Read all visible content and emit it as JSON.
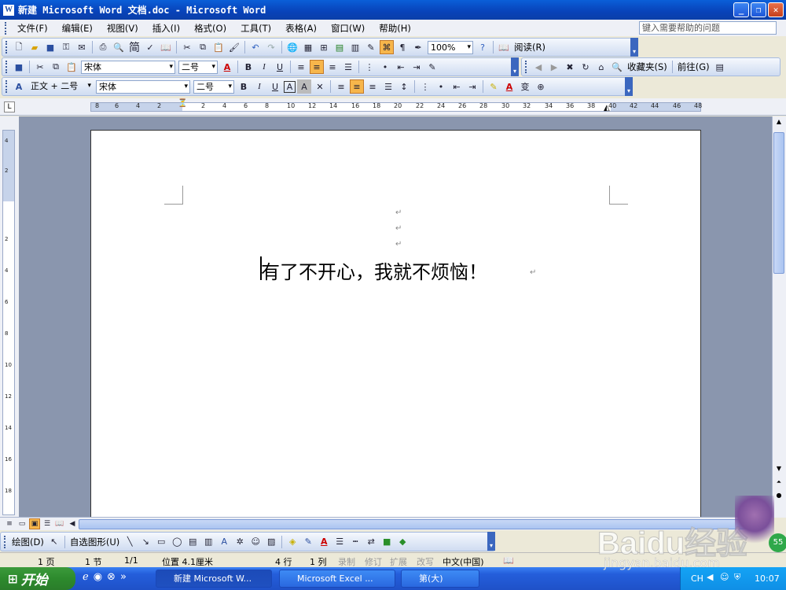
{
  "window": {
    "title": "新建 Microsoft Word 文档.doc - Microsoft Word",
    "app_icon": "W"
  },
  "menu": {
    "items": [
      "文件(F)",
      "编辑(E)",
      "视图(V)",
      "插入(I)",
      "格式(O)",
      "工具(T)",
      "表格(A)",
      "窗口(W)",
      "帮助(H)"
    ],
    "help_placeholder": "键入需要帮助的问题"
  },
  "toolbar_standard": {
    "zoom": "100%",
    "read_label": "阅读(R)",
    "simp_label": "简"
  },
  "toolbar_format": {
    "font": "宋体",
    "size": "二号",
    "favorites": "收藏夹(S)",
    "goto": "前往(G)"
  },
  "toolbar_format2": {
    "style": "正文 + 二号",
    "font": "宋体",
    "size": "二号"
  },
  "ruler": {
    "marks": [
      "8",
      "6",
      "4",
      "2",
      "2",
      "4",
      "6",
      "8",
      "10",
      "12",
      "14",
      "16",
      "18",
      "20",
      "22",
      "24",
      "26",
      "28",
      "30",
      "32",
      "34",
      "36",
      "38",
      "40",
      "42",
      "44",
      "46",
      "48"
    ],
    "vmarks": [
      "4",
      "2",
      "2",
      "4",
      "6",
      "8",
      "10",
      "12",
      "14",
      "16",
      "18"
    ]
  },
  "document": {
    "body_text": "有了不开心，我就不烦恼！",
    "para_mark": "↵"
  },
  "drawing": {
    "draw_label": "绘图(D)",
    "autoshapes_label": "自选图形(U)"
  },
  "status": {
    "page": "1 页",
    "section": "1 节",
    "pages": "1/1",
    "position": "位置 4.1厘米",
    "line": "4 行",
    "column": "1 列",
    "rec": "录制",
    "trk": "修订",
    "ext": "扩展",
    "ovr": "改写",
    "lang": "中文(中国)"
  },
  "taskbar": {
    "start": "开始",
    "tasks": [
      "新建 Microsoft W...",
      "Microsoft Excel ...",
      "第(大)"
    ],
    "tray_lang": "CH",
    "clock": "10:07"
  },
  "watermark": {
    "brand": "Baidu经验",
    "url": "jingyan.baidu.com"
  }
}
